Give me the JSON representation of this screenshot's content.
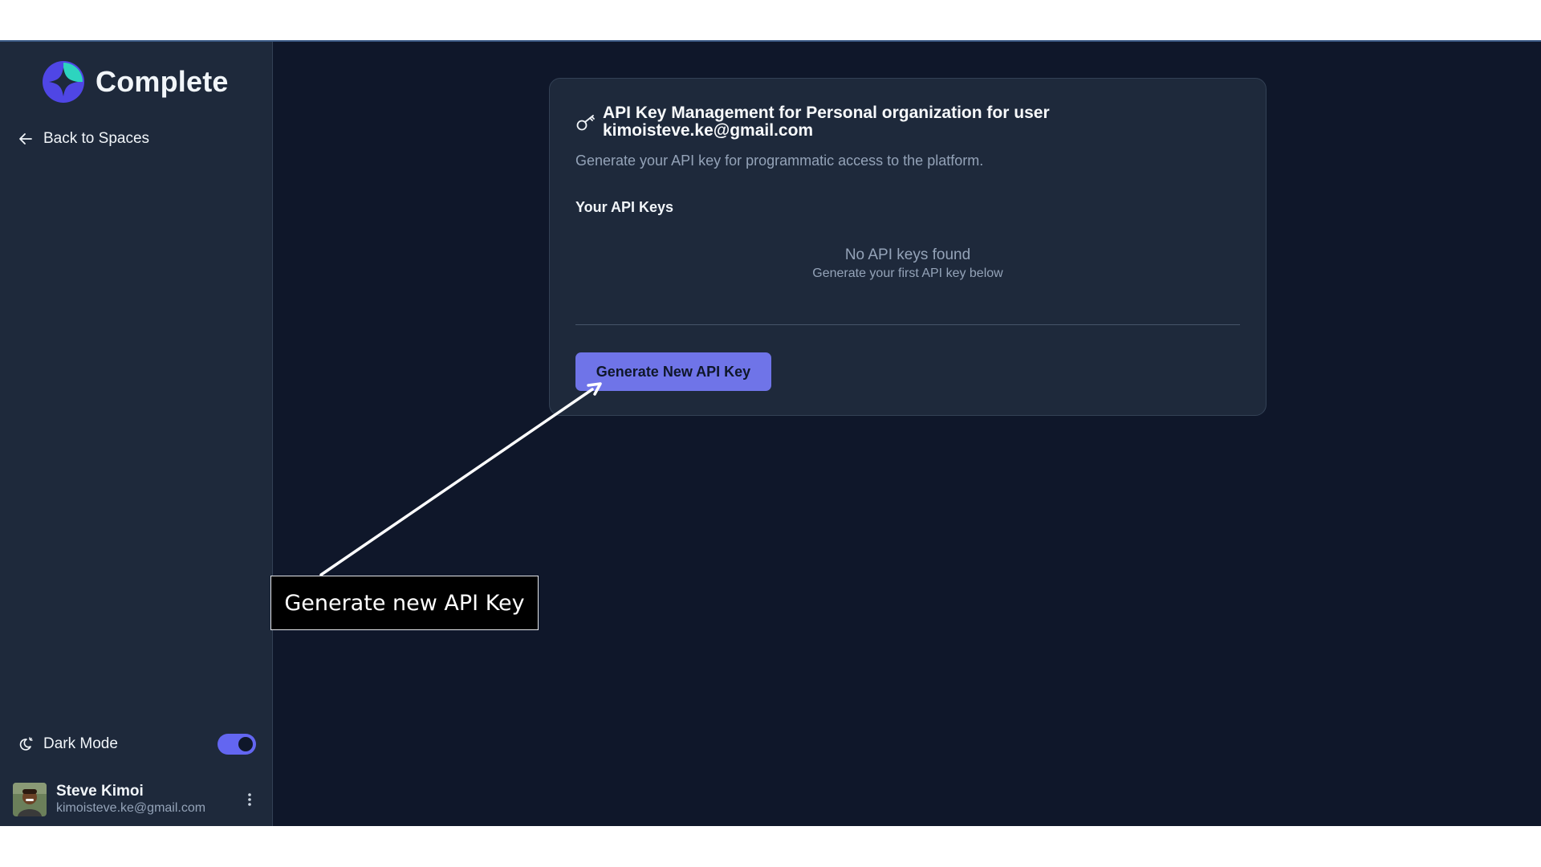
{
  "app": {
    "name": "Complete"
  },
  "sidebar": {
    "back_label": "Back to Spaces",
    "dark_mode_label": "Dark Mode",
    "dark_mode_on": true,
    "user": {
      "name": "Steve Kimoi",
      "email": "kimoisteve.ke@gmail.com"
    }
  },
  "card": {
    "title": "API Key Management for Personal organization for user kimoisteve.ke@gmail.com",
    "subtitle": "Generate your API key for programmatic access to the platform.",
    "section_title": "Your API Keys",
    "empty_title": "No API keys found",
    "empty_subtitle": "Generate your first API key below",
    "generate_button": "Generate New API Key"
  },
  "annotation": {
    "label": "Generate new API Key"
  },
  "colors": {
    "background": "#0f172a",
    "sidebar": "#1e293b",
    "accent": "#6366f1",
    "button": "#6f74e8"
  },
  "icons": {
    "back": "arrow-left-icon",
    "key": "key-icon",
    "theme": "moon-sun-icon",
    "menu": "more-vertical-icon"
  }
}
